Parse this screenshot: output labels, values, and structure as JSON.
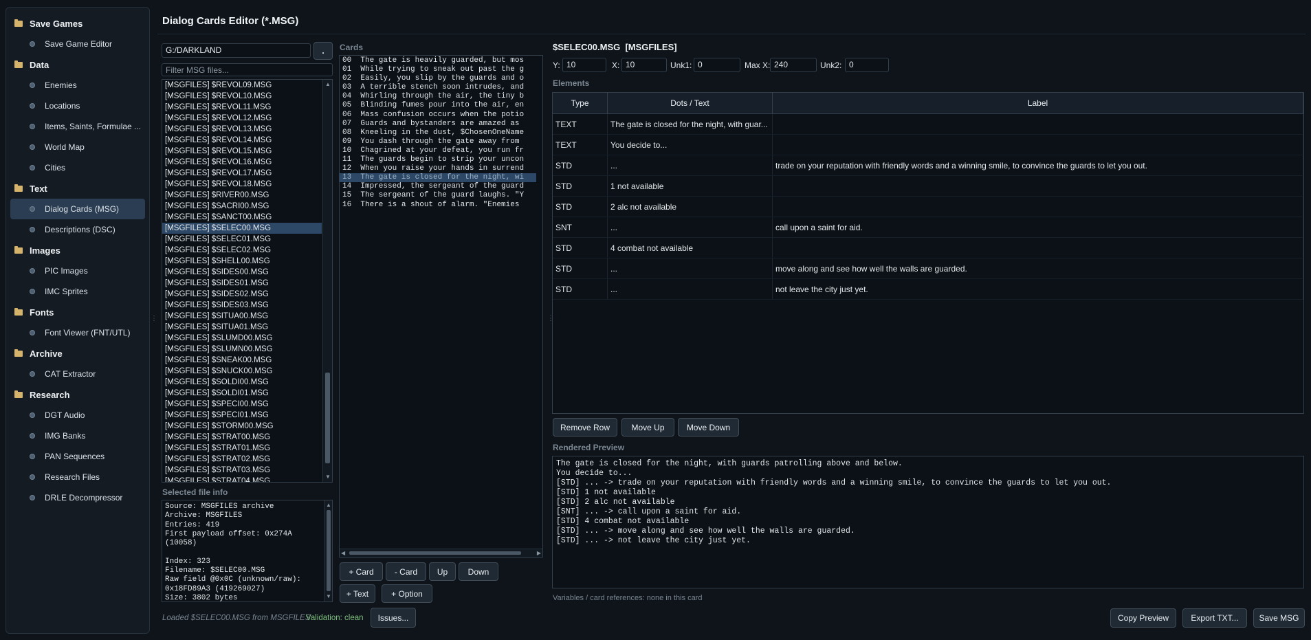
{
  "sidebar": {
    "sections": [
      {
        "label": "Save Games",
        "items": [
          {
            "label": "Save Game Editor"
          }
        ]
      },
      {
        "label": "Data",
        "items": [
          {
            "label": "Enemies"
          },
          {
            "label": "Locations"
          },
          {
            "label": "Items, Saints, Formulae ..."
          },
          {
            "label": "World Map"
          },
          {
            "label": "Cities"
          }
        ]
      },
      {
        "label": "Text",
        "items": [
          {
            "label": "Dialog Cards (MSG)",
            "active": true
          },
          {
            "label": "Descriptions (DSC)"
          }
        ]
      },
      {
        "label": "Images",
        "items": [
          {
            "label": "PIC Images"
          },
          {
            "label": "IMC Sprites"
          }
        ]
      },
      {
        "label": "Fonts",
        "items": [
          {
            "label": "Font Viewer (FNT/UTL)"
          }
        ]
      },
      {
        "label": "Archive",
        "items": [
          {
            "label": "CAT Extractor"
          }
        ]
      },
      {
        "label": "Research",
        "items": [
          {
            "label": "DGT Audio"
          },
          {
            "label": "IMG Banks"
          },
          {
            "label": "PAN Sequences"
          },
          {
            "label": "Research Files"
          },
          {
            "label": "DRLE Decompressor"
          }
        ]
      }
    ]
  },
  "header": {
    "title": "Dialog Cards Editor (*.MSG)"
  },
  "files": {
    "path": "G:/DARKLAND",
    "browse_label": ".",
    "filter_placeholder": "Filter MSG files...",
    "items": [
      "[MSGFILES] $REVOL09.MSG",
      "[MSGFILES] $REVOL10.MSG",
      "[MSGFILES] $REVOL11.MSG",
      "[MSGFILES] $REVOL12.MSG",
      "[MSGFILES] $REVOL13.MSG",
      "[MSGFILES] $REVOL14.MSG",
      "[MSGFILES] $REVOL15.MSG",
      "[MSGFILES] $REVOL16.MSG",
      "[MSGFILES] $REVOL17.MSG",
      "[MSGFILES] $REVOL18.MSG",
      "[MSGFILES] $RIVER00.MSG",
      "[MSGFILES] $SACRI00.MSG",
      "[MSGFILES] $SANCT00.MSG",
      "[MSGFILES] $SELEC00.MSG",
      "[MSGFILES] $SELEC01.MSG",
      "[MSGFILES] $SELEC02.MSG",
      "[MSGFILES] $SHELL00.MSG",
      "[MSGFILES] $SIDES00.MSG",
      "[MSGFILES] $SIDES01.MSG",
      "[MSGFILES] $SIDES02.MSG",
      "[MSGFILES] $SIDES03.MSG",
      "[MSGFILES] $SITUA00.MSG",
      "[MSGFILES] $SITUA01.MSG",
      "[MSGFILES] $SLUMD00.MSG",
      "[MSGFILES] $SLUMN00.MSG",
      "[MSGFILES] $SNEAK00.MSG",
      "[MSGFILES] $SNUCK00.MSG",
      "[MSGFILES] $SOLDI00.MSG",
      "[MSGFILES] $SOLDI01.MSG",
      "[MSGFILES] $SPECI00.MSG",
      "[MSGFILES] $SPECI01.MSG",
      "[MSGFILES] $STORM00.MSG",
      "[MSGFILES] $STRAT00.MSG",
      "[MSGFILES] $STRAT01.MSG",
      "[MSGFILES] $STRAT02.MSG",
      "[MSGFILES] $STRAT03.MSG",
      "[MSGFILES] $STRAT04.MSG"
    ],
    "selected_index": 13
  },
  "info": {
    "label": "Selected file info",
    "lines": [
      "Source: MSGFILES archive",
      "Archive: MSGFILES",
      "Entries: 419",
      "First payload offset: 0x274A",
      "(10058)",
      "",
      "Index: 323",
      "Filename: $SELEC00.MSG",
      "Raw field @0x0C (unknown/raw):",
      "0x18FD89A3 (419269027)",
      "Size: 3802 bytes"
    ]
  },
  "cards": {
    "label": "Cards",
    "items": [
      "00  The gate is heavily guarded, but mos",
      "01  While trying to sneak out past the g",
      "02  Easily, you slip by the guards and o",
      "03  A terrible stench soon intrudes, and",
      "04  Whirling through the air, the tiny b",
      "05  Blinding fumes pour into the air, en",
      "06  Mass confusion occurs when the potio",
      "07  Guards and bystanders are amazed as",
      "08  Kneeling in the dust, $ChosenOneName",
      "09  You dash through the gate away from",
      "10  Chagrined at your defeat, you run fr",
      "11  The guards begin to strip your uncon",
      "12  When you raise your hands in surrend",
      "13  The gate is closed for the night, wi",
      "14  Impressed, the sergeant of the guard",
      "15  The sergeant of the guard laughs. \"Y",
      "16  There is a shout of alarm. \"Enemies"
    ],
    "selected_index": 13,
    "buttons": {
      "add_card": "+ Card",
      "remove_card": "- Card",
      "up": "Up",
      "down": "Down",
      "add_text": "+ Text",
      "add_option": "+ Option"
    }
  },
  "editor": {
    "heading": "$SELEC00.MSG  [MSGFILES]",
    "fields": {
      "y_label": "Y:",
      "y": "10",
      "x_label": "X:",
      "x": "10",
      "unk1_label": "Unk1:",
      "unk1": "0",
      "maxx_label": "Max X:",
      "maxx": "240",
      "unk2_label": "Unk2:",
      "unk2": "0"
    },
    "elements_label": "Elements",
    "columns": [
      "Type",
      "Dots / Text",
      "Label"
    ],
    "rows": [
      {
        "type": "TEXT",
        "text": "The gate is closed for the night, with guar...",
        "label": ""
      },
      {
        "type": "TEXT",
        "text": "You decide to...",
        "label": ""
      },
      {
        "type": "STD",
        "text": "...",
        "label": "trade on your reputation with friendly words and a winning smile, to convince the guards to let you out."
      },
      {
        "type": "STD",
        "text": "1 not available",
        "label": ""
      },
      {
        "type": "STD",
        "text": "2 alc not available",
        "label": ""
      },
      {
        "type": "SNT",
        "text": "...",
        "label": "call upon a saint for aid."
      },
      {
        "type": "STD",
        "text": "4 combat not available",
        "label": ""
      },
      {
        "type": "STD",
        "text": "...",
        "label": "move along and see how well the walls are guarded."
      },
      {
        "type": "STD",
        "text": "...",
        "label": "not leave the city just yet."
      }
    ],
    "row_buttons": {
      "remove": "Remove Row",
      "up": "Move Up",
      "down": "Move Down"
    },
    "preview_label": "Rendered Preview",
    "preview_lines": [
      "The gate is closed for the night, with guards patrolling above and below.",
      "You decide to...",
      "[STD] ... -> trade on your reputation with friendly words and a winning smile, to convince the guards to let you out.",
      "[STD] 1 not available",
      "[STD] 2 alc not available",
      "[SNT] ... -> call upon a saint for aid.",
      "[STD] 4 combat not available",
      "[STD] ... -> move along and see how well the walls are guarded.",
      "[STD] ... -> not leave the city just yet."
    ],
    "variables_note": "Variables / card references: none in this card"
  },
  "status": {
    "loaded": "Loaded $SELEC00.MSG from MSGFILES",
    "validation": "Validation: clean",
    "issues_button": "Issues..."
  },
  "actions": {
    "copy_preview": "Copy Preview",
    "export_txt": "Export TXT...",
    "save_msg": "Save MSG"
  },
  "colors": {
    "accent_selection": "#2c4866",
    "validation_ok": "#7fbf7f",
    "folder": "#d6b36a"
  }
}
